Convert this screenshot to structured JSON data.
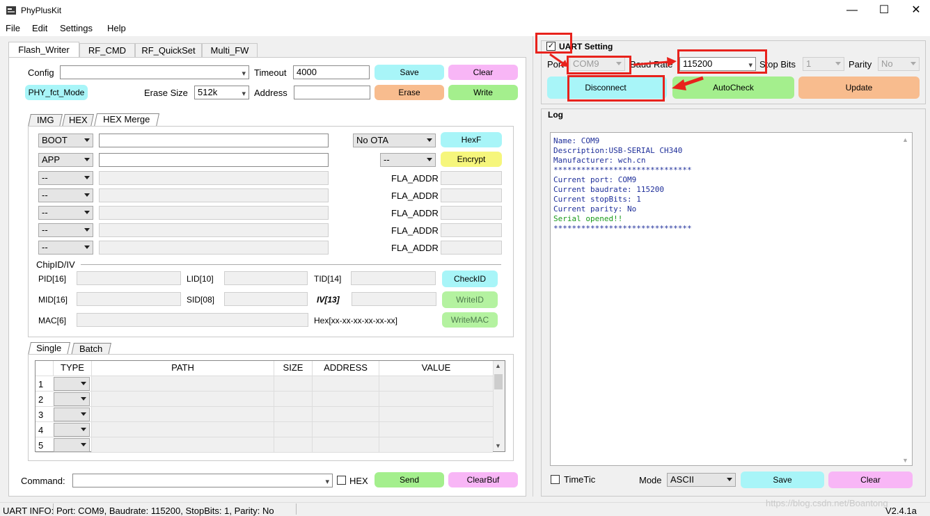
{
  "app": {
    "title": "PhyPlusKit"
  },
  "menu": [
    "File",
    "Edit",
    "Settings",
    "Help"
  ],
  "tabs": [
    "Flash_Writer",
    "RF_CMD",
    "RF_QuickSet",
    "Multi_FW"
  ],
  "flash": {
    "config_label": "Config",
    "config_value": "",
    "timeout_label": "Timeout",
    "timeout_value": "4000",
    "save": "Save",
    "clear": "Clear",
    "fct_mode": "PHY_fct_Mode",
    "erase_size_label": "Erase Size",
    "erase_size_value": "512k",
    "address_label": "Address",
    "address_value": "",
    "erase": "Erase",
    "write": "Write"
  },
  "img_tabs": [
    "IMG",
    "HEX",
    "HEX Merge"
  ],
  "hexmerge": {
    "boot": "BOOT",
    "app": "APP",
    "dash": "--",
    "ota": "No OTA",
    "hexf": "HexF",
    "encrypt_sel": "--",
    "encrypt": "Encrypt",
    "fla_addr": "FLA_ADDR"
  },
  "chip": {
    "legend": "ChipID/IV",
    "pid": "PID[16]",
    "lid": "LID[10]",
    "tid": "TID[14]",
    "mid": "MID[16]",
    "sid": "SID[08]",
    "iv": "IV[13]",
    "mac": "MAC[6]",
    "hexfmt": "Hex[xx-xx-xx-xx-xx-xx]",
    "checkid": "CheckID",
    "writeid": "WriteID",
    "writemac": "WriteMAC"
  },
  "mode_tabs": [
    "Single",
    "Batch"
  ],
  "table": {
    "headers": [
      "TYPE",
      "PATH",
      "SIZE",
      "ADDRESS",
      "VALUE"
    ],
    "rows": [
      "1",
      "2",
      "3",
      "4",
      "5"
    ]
  },
  "command": {
    "label": "Command:",
    "value": "",
    "hex": "HEX",
    "send": "Send",
    "clearbuf": "ClearBuf"
  },
  "uart": {
    "title": "UART Setting",
    "port_label": "Port",
    "port_value": "COM9",
    "baud_label": "Baud Rate",
    "baud_value": "115200",
    "stopbits_label": "Stop Bits",
    "stopbits_value": "1",
    "parity_label": "Parity",
    "parity_value": "No",
    "disconnect": "Disconnect",
    "autocheck": "AutoCheck",
    "update": "Update"
  },
  "log": {
    "title": "Log",
    "lines": [
      "Name: COM9",
      "Description:USB-SERIAL CH340",
      "Manufacturer: wch.cn",
      "******************************",
      "Current port: COM9",
      "Current baudrate: 115200",
      "Current stopBits: 1",
      "Current parity: No",
      "Serial opened!!",
      "******************************"
    ],
    "timetic": "TimeTic",
    "mode_label": "Mode",
    "mode_value": "ASCII",
    "save": "Save",
    "clear": "Clear"
  },
  "status": {
    "info": "UART INFO:",
    "text": "Port: COM9, Baudrate: 115200, StopBits: 1, Parity: No",
    "version": "V2.4.1a",
    "watermark": "https://blog.csdn.net/Boantong"
  },
  "colors": {
    "annotation": "#e8221c",
    "cyan": "#a8f5f8",
    "pink": "#f8b6f6",
    "green": "#a4ef8d",
    "orange": "#f8bc8e"
  }
}
